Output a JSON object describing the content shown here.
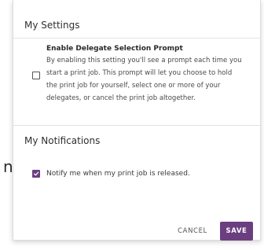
{
  "background": {
    "partial_text": "n"
  },
  "settings_section": {
    "title": "My Settings",
    "delegate_prompt": {
      "title": "Enable Delegate Selection Prompt",
      "description_lines": [
        "By enabling this setting you'll see a prompt each time you",
        "start a print job. This prompt will let you choose to hold",
        "the print job for yourself, select one or more of your",
        "delegates, or cancel the print job altogether."
      ],
      "checked": false
    }
  },
  "notifications_section": {
    "title": "My Notifications",
    "release_notification": {
      "label": "Notify me when my print job is released.",
      "checked": true
    }
  },
  "actions": {
    "cancel_label": "CANCEL",
    "save_label": "SAVE"
  },
  "colors": {
    "accent": "#6b3f7f",
    "divider": "#e3e3e3",
    "text": "#2f2f2f"
  }
}
